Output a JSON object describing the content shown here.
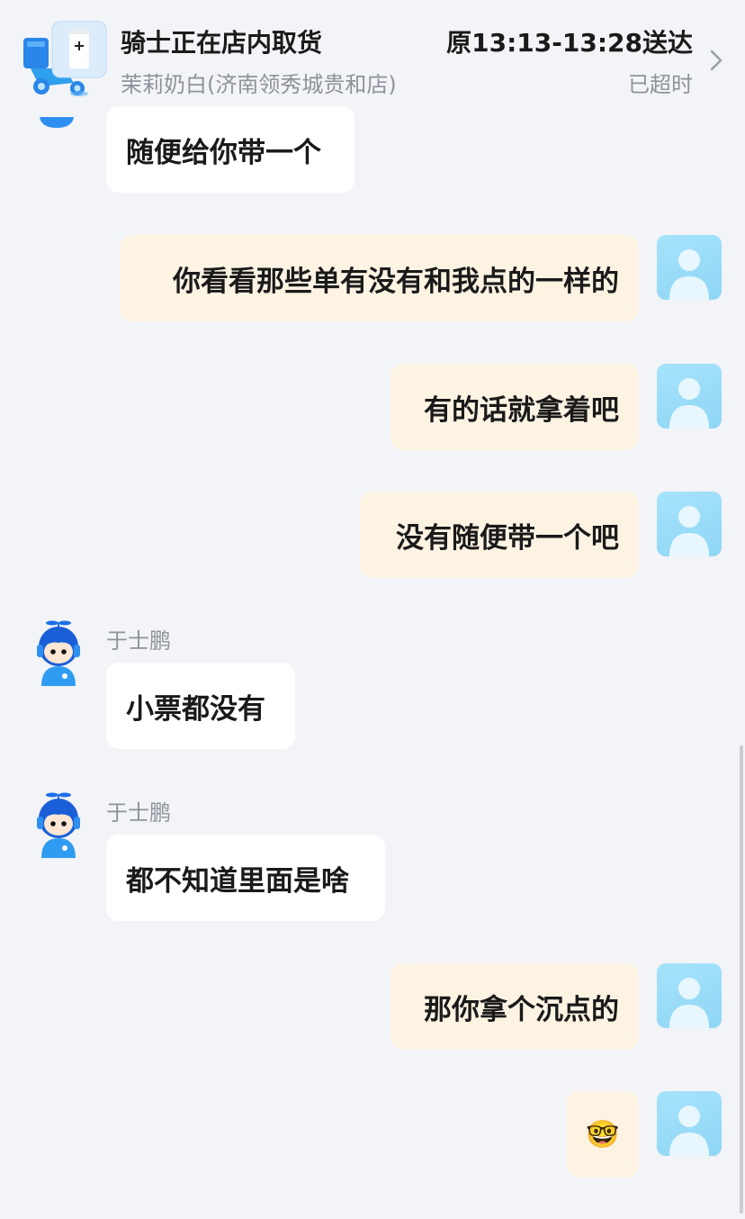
{
  "header": {
    "title": "骑士正在店内取货",
    "subtitle": "茉莉奶白(济南领秀城贵和店)",
    "eta": "原13:13-13:28送达",
    "status": "已超时"
  },
  "messages": [
    {
      "side": "left",
      "text": "随便给你带一个"
    },
    {
      "side": "right",
      "text": "你看看那些单有没有和我点的一样的"
    },
    {
      "side": "right",
      "text": "有的话就拿着吧"
    },
    {
      "side": "right",
      "text": "没有随便带一个吧"
    },
    {
      "side": "left",
      "sender": "于士鹏",
      "text": "小票都没有"
    },
    {
      "side": "left",
      "sender": "于士鹏",
      "text": "都不知道里面是啥"
    },
    {
      "side": "right",
      "text": "那你拿个沉点的"
    },
    {
      "side": "right",
      "text": "🤓"
    }
  ],
  "colors": {
    "background": "#f3f4f7",
    "left_bubble": "#ffffff",
    "right_bubble": "#fdf3e3",
    "avatar": "#9edcf8",
    "rider_blue": "#1e6fe8"
  }
}
